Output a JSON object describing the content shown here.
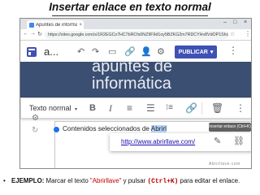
{
  "slide": {
    "title": "Insertar enlace en texto normal",
    "caption": {
      "bullet": "•",
      "label": "EJEMPLO:",
      "text1": " Marcar el texto ",
      "highlight": "\"Abrirllave\"",
      "text2": " y pulsar ",
      "shortcut": "(Ctrl+K)",
      "text3": " para editar el enlace."
    }
  },
  "browser": {
    "tab_title": "Apuntes de informática",
    "tab_close": "×",
    "window_controls": {
      "minimize": "–",
      "maximize": "□",
      "close": "×"
    },
    "url": "https://sites.google.com/s/1R2EGCs7HC7bRCfs0NZ9F9d1oy5BZKG2m7RDCYHv8VdOP1Sh/p/",
    "nav": {
      "back": "←",
      "forward": "→",
      "reload": "↻"
    },
    "star": "☆",
    "menu": "⋮"
  },
  "sites_header": {
    "site_name": "a...",
    "icons": {
      "undo": "↶",
      "redo": "↷",
      "preview": "▭",
      "link": "🔗",
      "add_user": "👤",
      "gear": "⚙",
      "more": "⋮"
    },
    "publish_label": "PUBLICAR",
    "publish_caret": "▾"
  },
  "banner": {
    "title_line1": "apuntes de",
    "title_line2": "informática"
  },
  "toolbar": {
    "style_label": "Texto normal",
    "style_caret": "▾",
    "buttons": {
      "bold": "B",
      "italic": "I",
      "align": "≡",
      "list": "☰",
      "numbered_list": "⁝≡",
      "link": "🔗",
      "delete": "🗑",
      "more": "⋮"
    }
  },
  "tooltip": "Insertar enlace (Ctrl+K)",
  "content": {
    "text_before": "Contenidos seleccionados de ",
    "selected": "Abrirl",
    "gear_icon": "⚙",
    "rotate_icon": "↻"
  },
  "link_popup": {
    "url": "http://www.abrirllave.com/",
    "edit": "✎",
    "unlink": "⛓"
  },
  "watermark": "Abrirllave.com"
}
